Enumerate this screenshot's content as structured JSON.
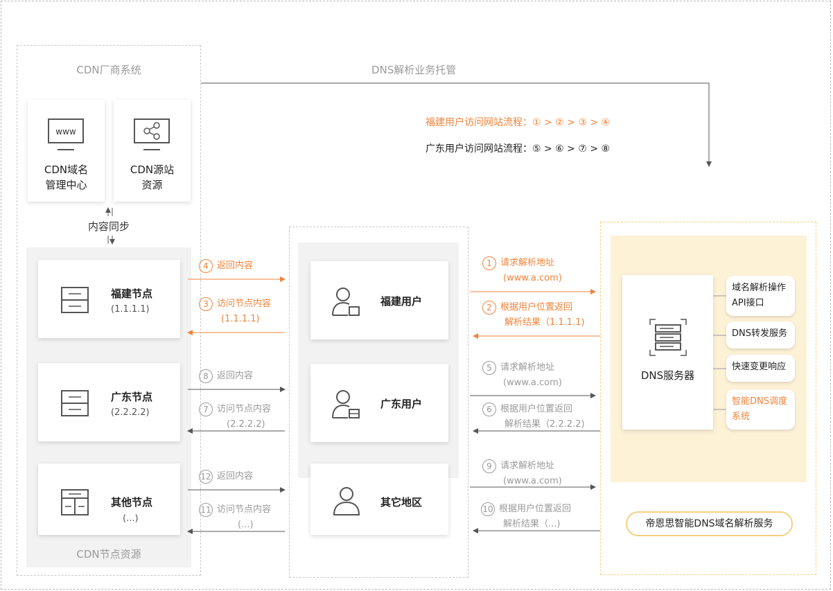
{
  "left_panel": {
    "title": "CDN厂商系统",
    "mgmt_card": {
      "icon_text": "www",
      "line1": "CDN域名",
      "line2": "管理中心"
    },
    "origin_card": {
      "line1": "CDN源站",
      "line2": "资源"
    },
    "sync_label": "内容同步",
    "nodes_title": "CDN节点资源",
    "nodes": [
      {
        "name": "福建节点",
        "ip": "(1.1.1.1)"
      },
      {
        "name": "广东节点",
        "ip": "(2.2.2.2)"
      },
      {
        "name": "其他节点",
        "ip": "(...)"
      }
    ]
  },
  "top_flow": {
    "hosting_label": "DNS解析业务托管",
    "fujian_flow": "福建用户访问网站流程：① > ② > ③ > ④",
    "guangdong_flow": "广东用户访问网站流程：⑤ > ⑥ > ⑦ > ⑧"
  },
  "left_arrows": [
    {
      "num": "4",
      "line1": "返回内容",
      "line2": ""
    },
    {
      "num": "3",
      "line1": "访问节点内容",
      "line2": "(1.1.1.1)"
    },
    {
      "num": "8",
      "line1": "返回内容",
      "line2": ""
    },
    {
      "num": "7",
      "line1": "访问节点内容",
      "line2": "(2.2.2.2)"
    },
    {
      "num": "12",
      "line1": "返回内容",
      "line2": ""
    },
    {
      "num": "11",
      "line1": "访问节点内容",
      "line2": "(...)"
    }
  ],
  "users": [
    {
      "name": "福建用户"
    },
    {
      "name": "广东用户"
    },
    {
      "name": "其它地区"
    }
  ],
  "right_arrows": [
    {
      "num": "1",
      "line1": "请求解析地址",
      "line2": "(www.a.com)"
    },
    {
      "num": "2",
      "line1": "根据用户位置返回",
      "line2": "解析结果（1.1.1.1)"
    },
    {
      "num": "5",
      "line1": "请求解析地址",
      "line2": "(www.a.com)"
    },
    {
      "num": "6",
      "line1": "根据用户位置返回",
      "line2": "解析结果（2.2.2.2)"
    },
    {
      "num": "9",
      "line1": "请求解析地址",
      "line2": "(www.a.com)"
    },
    {
      "num": "10",
      "line1": "根据用户位置返回",
      "line2": "解析结果（...)"
    }
  ],
  "dns": {
    "server_label": "DNS服务器",
    "features": [
      {
        "line1": "域名解析操作",
        "line2": "API接口"
      },
      {
        "line1": "DNS转发服务",
        "line2": ""
      },
      {
        "line1": "快速变更响应",
        "line2": ""
      },
      {
        "line1": "智能DNS调度",
        "line2": "系统"
      }
    ],
    "service_name": "帝恩思智能DNS域名解析服务"
  },
  "colors": {
    "accent": "#f0833a",
    "line": "#555555",
    "muted": "#9a9a9a",
    "panel": "#fdf1d6",
    "badge_border": "#f5cf7f"
  }
}
